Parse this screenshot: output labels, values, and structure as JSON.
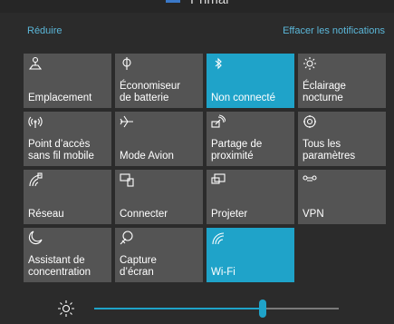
{
  "top": {
    "partial_title": "Primar"
  },
  "header": {
    "collapse_label": "Réduire",
    "clear_label": "Effacer les notifications"
  },
  "tiles": [
    {
      "label": "Emplacement",
      "icon": "location-icon",
      "active": false
    },
    {
      "label": "Économiseur\nde batterie",
      "icon": "battery-saver-icon",
      "active": false
    },
    {
      "label": "Non connecté",
      "icon": "bluetooth-icon",
      "active": true
    },
    {
      "label": "Éclairage\nnocturne",
      "icon": "night-light-icon",
      "active": false
    },
    {
      "label": "Point d’accès\nsans fil mobile",
      "icon": "mobile-hotspot-icon",
      "active": false
    },
    {
      "label": "Mode Avion",
      "icon": "airplane-icon",
      "active": false
    },
    {
      "label": "Partage de\nproximité",
      "icon": "nearby-sharing-icon",
      "active": false
    },
    {
      "label": "Tous les\nparamètres",
      "icon": "settings-gear-icon",
      "active": false
    },
    {
      "label": "Réseau",
      "icon": "network-icon",
      "active": false
    },
    {
      "label": "Connecter",
      "icon": "connect-icon",
      "active": false
    },
    {
      "label": "Projeter",
      "icon": "project-icon",
      "active": false
    },
    {
      "label": "VPN",
      "icon": "vpn-icon",
      "active": false
    },
    {
      "label": "Assistant de\nconcentration",
      "icon": "focus-assist-icon",
      "active": false
    },
    {
      "label": "Capture\nd’écran",
      "icon": "screen-snip-icon",
      "active": false
    },
    {
      "label": "Wi-Fi",
      "icon": "wifi-icon",
      "active": true
    }
  ],
  "brightness": {
    "icon": "brightness-icon",
    "level": 0.69
  },
  "colors": {
    "accent": "#1fa3c9",
    "tile": "#545454",
    "background": "#2b2b2b",
    "link": "#5bb7d9"
  }
}
